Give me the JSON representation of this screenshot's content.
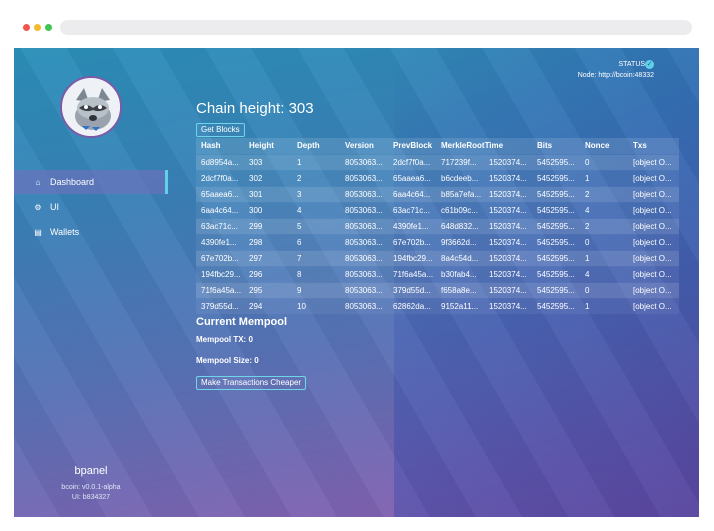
{
  "status": {
    "label": "STATUS:",
    "node": "Node: http://bcoin:48332"
  },
  "sidebar": {
    "items": [
      {
        "label": "Dashboard",
        "icon": "home-icon",
        "active": true
      },
      {
        "label": "UI",
        "icon": "gears-icon",
        "active": false
      },
      {
        "label": "Wallets",
        "icon": "wallet-icon",
        "active": false
      }
    ],
    "brand": {
      "name": "bpanel",
      "bcoin_version": "bcoin: v0.0.1-alpha",
      "ui_version": "UI: b834327"
    }
  },
  "main": {
    "chain_height": "Chain height: 303",
    "get_blocks_label": "Get Blocks",
    "table": {
      "headers": [
        "Hash",
        "Height",
        "Depth",
        "Version",
        "PrevBlock",
        "MerkleRootTime",
        "",
        "Bits",
        "Nonce",
        "Txs"
      ],
      "rows": [
        [
          "6d8954a...",
          "303",
          "1",
          "8053063...",
          "2dcf7f0a...",
          "717239f...",
          "152037​4...",
          "5452595...",
          "0",
          "[object O..."
        ],
        [
          "2dcf7f0a...",
          "302",
          "2",
          "8053063...",
          "65aaea6...",
          "b6cdeeb...",
          "1520374...",
          "5452595...",
          "1",
          "[object O..."
        ],
        [
          "65aaea6...",
          "301",
          "3",
          "8053063...",
          "6aa4c64...",
          "b85a7efa...",
          "1520374...",
          "5452595...",
          "2",
          "[object O..."
        ],
        [
          "6aa4c64...",
          "300",
          "4",
          "8053063...",
          "63ac71c...",
          "c61b09c...",
          "1520374...",
          "5452595...",
          "4",
          "[object O..."
        ],
        [
          "63ac71c...",
          "299",
          "5",
          "8053063...",
          "4390fe1...",
          "648d832...",
          "1520374...",
          "5452595...",
          "2",
          "[object O..."
        ],
        [
          "4390fe1...",
          "298",
          "6",
          "8053063...",
          "67e702b...",
          "9f3662d...",
          "1520374...",
          "5452595...",
          "0",
          "[object O..."
        ],
        [
          "67e702b...",
          "297",
          "7",
          "8053063...",
          "194fbc29...",
          "8a4c54d...",
          "1520374...",
          "5452595...",
          "1",
          "[object O..."
        ],
        [
          "194fbc29...",
          "296",
          "8",
          "8053063...",
          "71f6a45a...",
          "b30fab4...",
          "1520374...",
          "5452595...",
          "4",
          "[object O..."
        ],
        [
          "71f6a45a...",
          "295",
          "9",
          "8053063...",
          "379d55d...",
          "f658a8e...",
          "1520374...",
          "5452595...",
          "0",
          "[object O..."
        ],
        [
          "379d55d...",
          "294",
          "10",
          "8053063...",
          "62862da...",
          "9152a11...",
          "1520374...",
          "5452595...",
          "1",
          "[object O..."
        ]
      ]
    },
    "mempool": {
      "title": "Current Mempool",
      "tx": "Mempool TX: 0",
      "size": "Mempool Size: 0",
      "cheaper_label": "Make Transactions Cheaper"
    }
  },
  "colors": {
    "accent": "#5fd1e8",
    "avatar_border": "#7c5aa8"
  }
}
